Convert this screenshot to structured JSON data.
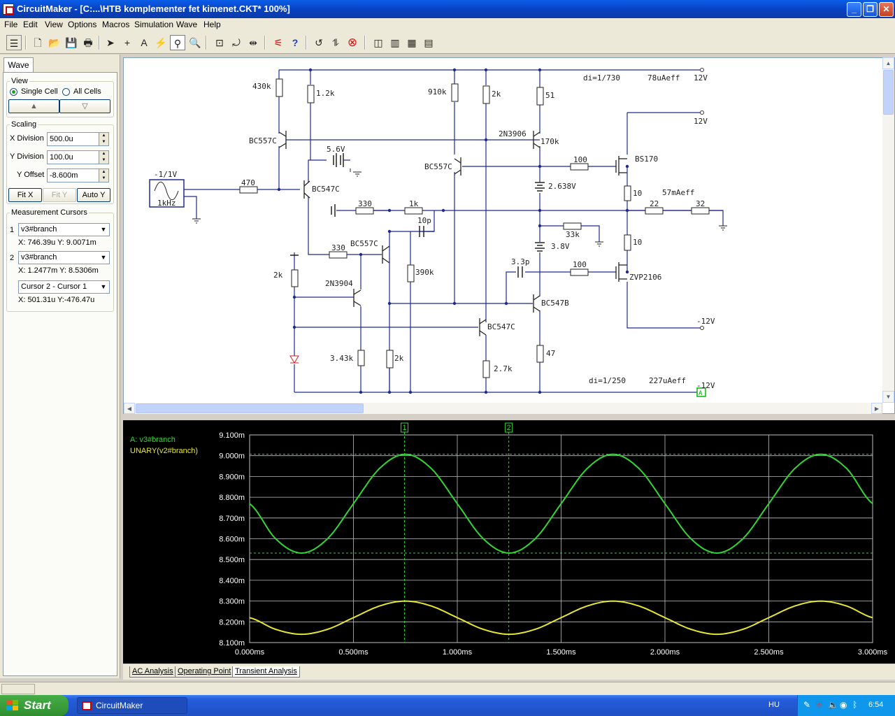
{
  "window": {
    "title": "CircuitMaker - [C:...\\HTB komplementer fet kimenet.CKT* 100%]"
  },
  "menu": [
    "File",
    "Edit",
    "View",
    "Options",
    "Macros",
    "Simulation",
    "Wave",
    "Help"
  ],
  "left_panel": {
    "tab": "Wave",
    "view": {
      "title": "View",
      "single_cell": "Single Cell",
      "all_cells": "All Cells",
      "up": "▲",
      "down": "▽"
    },
    "scaling": {
      "title": "Scaling",
      "x_div_label": "X Division",
      "x_div_value": "500.0u",
      "y_div_label": "Y Division",
      "y_div_value": "100.0u",
      "y_off_label": "Y Offset",
      "y_off_value": "-8.600m",
      "fit_x": "Fit X",
      "fit_y": "Fit Y",
      "auto_y": "Auto Y"
    },
    "cursors": {
      "title": "Measurement Cursors",
      "c1_num": "1",
      "c1_sel": "v3#branch",
      "c1_x": "X: 746.39u",
      "c1_y": "Y: 9.0071m",
      "c2_num": "2",
      "c2_sel": "v3#branch",
      "c2_x": "X: 1.2477m",
      "c2_y": "Y: 8.5306m",
      "diff_sel": "Cursor 2 - Cursor 1",
      "diff_x": "X: 501.31u",
      "diff_y": "Y:-476.47u"
    }
  },
  "schematic": {
    "labels": {
      "r430k": "430k",
      "r12k": "1.2k",
      "r910k": "910k",
      "r2k_top": "2k",
      "r51": "51",
      "q_bc557_1": "BC557C",
      "q_2n3906": "2N3906",
      "r170k": "170k",
      "b56v": "5.6V",
      "q_bc557_2": "BC557C",
      "r100_a": "100",
      "m_bs170": "BS170",
      "src": "-1/1V",
      "src_freq": "1kHz",
      "r470": "470",
      "q_bc547_1": "BC547C",
      "b2638": "2.638V",
      "r10_a": "10",
      "r330_a": "330",
      "r1k": "1k",
      "r22": "22",
      "r32": "32",
      "c10p": "10p",
      "r33k": "33k",
      "q_bc557_3": "BC557C",
      "r330_b": "330",
      "b38": "3.8V",
      "r10_b": "10",
      "r2k_l": "2k",
      "r390k": "390k",
      "c33p": "3.3p",
      "r100_b": "100",
      "m_zvp": "ZVP2106",
      "q_2n3904": "2N3904",
      "q_bc547b": "BC547B",
      "q_bc547_2": "BC547C",
      "r343k": "3.43k",
      "r2k_m": "2k",
      "r27k": "2.7k",
      "r47": "47",
      "v12_a": "12V",
      "v12_b": "12V",
      "vm12_a": "-12V",
      "vm12_b": "-12V",
      "di_top": "di=1/730",
      "i_top": "78uAeff",
      "i_out": "57mAeff",
      "di_bot": "di=1/250",
      "i_bot": "227uAeff",
      "probe": "A"
    }
  },
  "chart_data": {
    "type": "line",
    "xlabel": "",
    "ylabel": "",
    "xlim": [
      0.0,
      3.0
    ],
    "ylim": [
      8.1,
      9.1
    ],
    "x_ticks": [
      "0.000ms",
      "0.500ms",
      "1.000ms",
      "1.500ms",
      "2.000ms",
      "2.500ms",
      "3.000ms"
    ],
    "y_ticks": [
      "9.100m",
      "9.000m",
      "8.900m",
      "8.800m",
      "8.700m",
      "8.600m",
      "8.500m",
      "8.400m",
      "8.300m",
      "8.200m",
      "8.100m"
    ],
    "grid": true,
    "legend_position": "top-left",
    "cursors": [
      {
        "label": "1",
        "x": 0.746
      },
      {
        "label": "2",
        "x": 1.248
      }
    ],
    "cursor_levels": [
      9.007,
      8.531
    ],
    "series": [
      {
        "name": "A: v3#branch",
        "color": "#33d633",
        "x": [
          0.0,
          0.125,
          0.25,
          0.375,
          0.5,
          0.625,
          0.75,
          0.875,
          1.0,
          1.125,
          1.25,
          1.375,
          1.5,
          1.625,
          1.75,
          1.875,
          2.0,
          2.125,
          2.25,
          2.375,
          2.5,
          2.625,
          2.75,
          2.875,
          3.0
        ],
        "y": [
          8.769,
          8.6,
          8.531,
          8.6,
          8.769,
          8.938,
          9.007,
          8.938,
          8.769,
          8.6,
          8.531,
          8.6,
          8.769,
          8.938,
          9.007,
          8.938,
          8.769,
          8.6,
          8.531,
          8.6,
          8.769,
          8.938,
          9.007,
          8.938,
          8.769
        ]
      },
      {
        "name": "UNARY(v2#branch)",
        "color": "#e6e633",
        "x": [
          0.0,
          0.125,
          0.25,
          0.375,
          0.5,
          0.625,
          0.75,
          0.875,
          1.0,
          1.125,
          1.25,
          1.375,
          1.5,
          1.625,
          1.75,
          1.875,
          2.0,
          2.125,
          2.25,
          2.375,
          2.5,
          2.625,
          2.75,
          2.875,
          3.0
        ],
        "y": [
          8.22,
          8.164,
          8.14,
          8.164,
          8.22,
          8.276,
          8.3,
          8.276,
          8.22,
          8.164,
          8.14,
          8.164,
          8.22,
          8.276,
          8.3,
          8.276,
          8.22,
          8.164,
          8.14,
          8.164,
          8.22,
          8.276,
          8.3,
          8.276,
          8.22
        ]
      }
    ]
  },
  "bottom_tabs": [
    "AC Analysis",
    "Operating Point",
    "Transient Analysis"
  ],
  "taskbar": {
    "start": "Start",
    "app": "CircuitMaker",
    "lang": "HU",
    "clock": "6:54"
  },
  "colors": {
    "wire": "#1e2a8c",
    "trace1": "#33d633",
    "trace2": "#e6e633",
    "grid": "#bfbfbf"
  }
}
